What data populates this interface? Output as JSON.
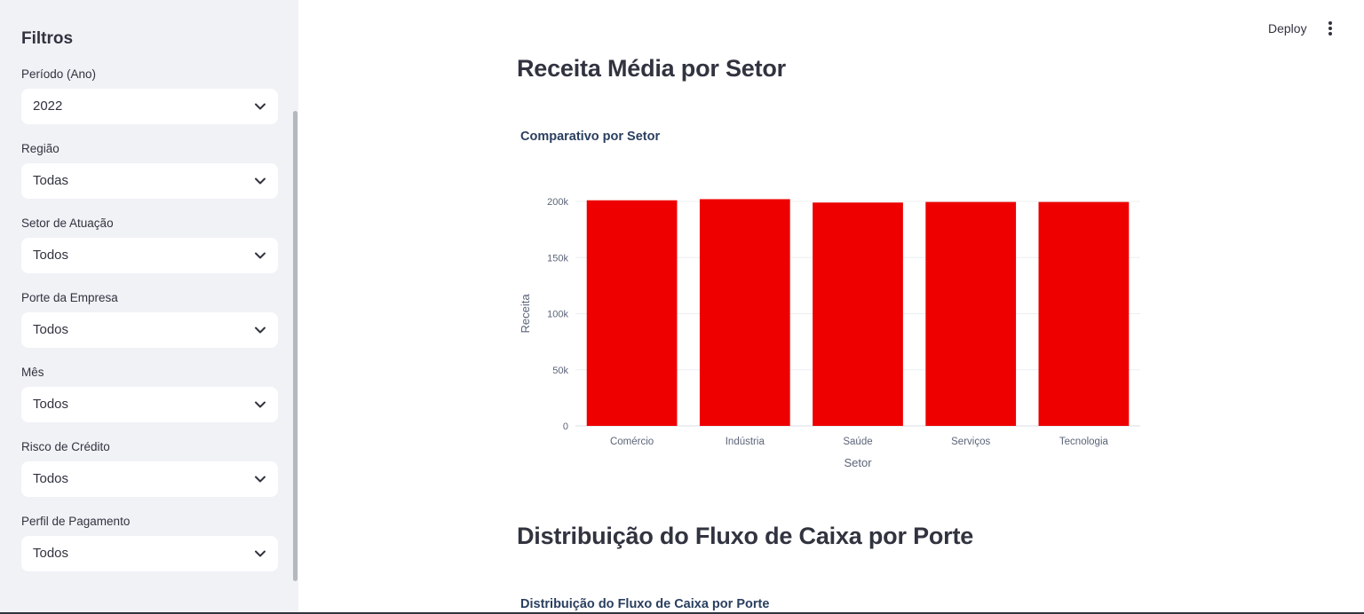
{
  "sidebar": {
    "title": "Filtros",
    "filters": [
      {
        "label": "Período (Ano)",
        "value": "2022"
      },
      {
        "label": "Região",
        "value": "Todas"
      },
      {
        "label": "Setor de Atuação",
        "value": "Todos"
      },
      {
        "label": "Porte da Empresa",
        "value": "Todos"
      },
      {
        "label": "Mês",
        "value": "Todos"
      },
      {
        "label": "Risco de Crédito",
        "value": "Todos"
      },
      {
        "label": "Perfil de Pagamento",
        "value": "Todos"
      }
    ]
  },
  "header": {
    "deploy_label": "Deploy",
    "menu_icon": "more-vertical-icon"
  },
  "main": {
    "section1_title": "Receita Média por Setor",
    "chart1_title": "Comparativo por Setor",
    "section2_title": "Distribuição do Fluxo de Caixa por Porte",
    "chart2_title": "Distribuição do Fluxo de Caixa por Porte"
  },
  "colors": {
    "bar": "#ee0000",
    "sidebar_bg": "#f0f2f6",
    "text": "#31333f"
  },
  "chart_data": {
    "type": "bar",
    "title": "Comparativo por Setor",
    "xlabel": "Setor",
    "ylabel": "Receita",
    "categories": [
      "Comércio",
      "Indústria",
      "Saúde",
      "Serviços",
      "Tecnologia"
    ],
    "values": [
      201000,
      202000,
      199000,
      199500,
      199500
    ],
    "ylim": [
      0,
      200000
    ],
    "yticks": [
      0,
      50000,
      100000,
      150000,
      200000
    ],
    "ytick_labels": [
      "0",
      "50k",
      "100k",
      "150k",
      "200k"
    ],
    "grid": true,
    "color": "#ee0000"
  }
}
